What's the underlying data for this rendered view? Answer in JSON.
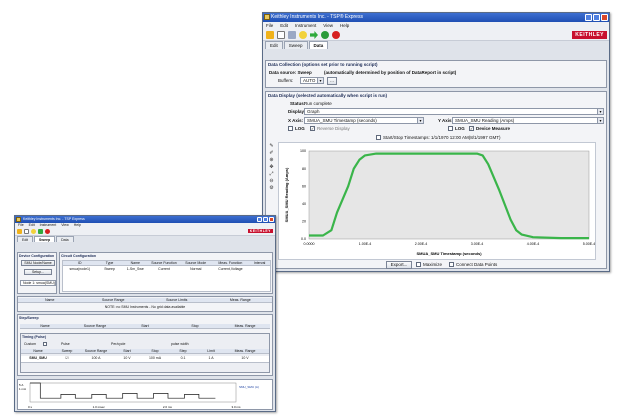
{
  "large": {
    "title": "Keithley Instruments Inc. - TSP® Express",
    "menu": [
      "File",
      "Edit",
      "Instrument",
      "View",
      "Help"
    ],
    "brand": "KEITHLEY",
    "tabs": [
      "Edit",
      "Sweep",
      "Data"
    ],
    "collection": {
      "title": "Data Collection (options set prior to running script)",
      "source_label": "Data source: Sweep",
      "source_note": "(automatically determined by position of DataReport in script)",
      "buffers_label": "Buffers:",
      "buffers_value": "AUTO"
    },
    "display": {
      "title": "Data Display (selected automatically when script is run)",
      "status_label": "Status:",
      "status_value": "Run complete",
      "display_label": "Display:",
      "display_value": "Graph",
      "xaxis_label": "X Axis:",
      "xaxis_value": "SMUA_SMU Timestamp (seconds)",
      "yaxis_label": "Y Axis:",
      "yaxis_value": "SMUA_SMU Reading (Amps)",
      "log_x": "LOG",
      "invert_x": "Reverse Display",
      "log_y": "LOG",
      "device_measure": "Device Measure",
      "start_time": "Start/Stop Timestamps: 1/1/1970 12:00 AM(8/1/1997 GMT)"
    },
    "chart_data": {
      "type": "line",
      "xlabel": "SMUA_SMU Timestamp (seconds)",
      "ylabel": "SMUA_SMU Reading (Amps)",
      "xticks": [
        "0.0000",
        "1.00E-4",
        "2.00E-4",
        "3.00E-4",
        "4.00E-4",
        "5.00E-4"
      ],
      "yticks": [
        "0.0",
        "20",
        "40",
        "60",
        "80",
        "100"
      ],
      "xlim": [
        0,
        0.0005
      ],
      "ylim": [
        0,
        100
      ],
      "grid": false,
      "series": [
        {
          "color": "#3ab54a",
          "x": [
            0,
            2.5e-05,
            4e-05,
            5e-05,
            7e-05,
            8e-05,
            9e-05,
            0.0001,
            0.00012,
            0.00025,
            0.0003,
            0.00031,
            0.00032,
            0.00034,
            0.00036,
            0.00037,
            0.00038,
            0.0004,
            0.00045,
            0.0005
          ],
          "y": [
            4,
            4,
            10,
            30,
            60,
            80,
            90,
            95,
            97,
            97,
            97,
            95,
            85,
            55,
            22,
            10,
            5,
            2,
            1,
            1
          ]
        }
      ]
    },
    "buttons": {
      "export": "Export...",
      "maximize": "Maximize",
      "connect": "Connect Data Points"
    }
  },
  "small": {
    "title": "Keithley Instruments Inc. - TSP Express",
    "menu": [
      "File",
      "Edit",
      "Instrument",
      "View",
      "Help"
    ],
    "brand": "KEITHLEY",
    "tabs": [
      "Edit",
      "Sweep",
      "Data"
    ],
    "device_config": "Device Configuration",
    "smu_label": "SMU Node/Name",
    "setup_button": "Setup...",
    "smu_value": "Node 1: smua(SMU)",
    "circuit_title": "Circuit Configuration",
    "circuit_headers": [
      "ID",
      "Type",
      "Name",
      "Source Function",
      "Source Mode",
      "Meas. Function",
      "Interval"
    ],
    "circuit_row": [
      "smua(node1)",
      "Sweep",
      "1-Sm_Swe",
      "Current",
      "Normal",
      "Current,Voltage",
      ""
    ],
    "meas_headers": [
      "Name",
      "Source Range",
      "Source Limits",
      "Meas. Range"
    ],
    "meas_note": "NOTE: no SMU Instruments - No grid data available",
    "step_title": "Step/Sweep",
    "step_headers": [
      "Name",
      "Source Range",
      "Start",
      "Stop",
      "Meas. Range"
    ],
    "timing_title": "Timing (Pulse)",
    "timing_labels": [
      "Custom",
      "Pulse",
      "Per/cycle",
      "pulse width"
    ],
    "sweep_headers": [
      "Name",
      "Sweep",
      "Source Range",
      "Start",
      "Stop",
      "Step",
      "Limit",
      "Meas. Range"
    ],
    "sweep_row": [
      "SMU_SMU",
      "",
      "100 A",
      "10 V",
      "100 mA",
      "0.1",
      "1 A",
      "10 V"
    ],
    "chart_data": {
      "type": "line",
      "xticks": [
        "0 s",
        "1.0 msec",
        "2.0 ms",
        "3.0 ms"
      ],
      "yticks": [
        "5 A",
        "1 mA"
      ],
      "series": [
        {
          "color": "#1a1a1a",
          "x": [
            0,
            0.05,
            0.05,
            0.15,
            0.15,
            0.22,
            0.22,
            0.3,
            0.3,
            0.37,
            0.37,
            0.45,
            0.45,
            0.52,
            0.52,
            0.6,
            0.6,
            0.67,
            0.67,
            0.75,
            0.75,
            0.82,
            0.82,
            0.9
          ],
          "y": [
            1,
            1,
            0.2,
            0.2,
            0.4,
            0.4,
            0.2,
            0.2,
            0.4,
            0.4,
            0.2,
            0.2,
            0.45,
            0.45,
            0.2,
            0.2,
            0.45,
            0.45,
            0.2,
            0.2,
            0.4,
            0.4,
            0.2,
            0.2
          ]
        }
      ],
      "legend": "SMU_SMU (A)"
    }
  },
  "colors": {
    "titlebar": "#2a5cc4",
    "plot_line": "#3ab54a",
    "brand": "#c8102e"
  }
}
